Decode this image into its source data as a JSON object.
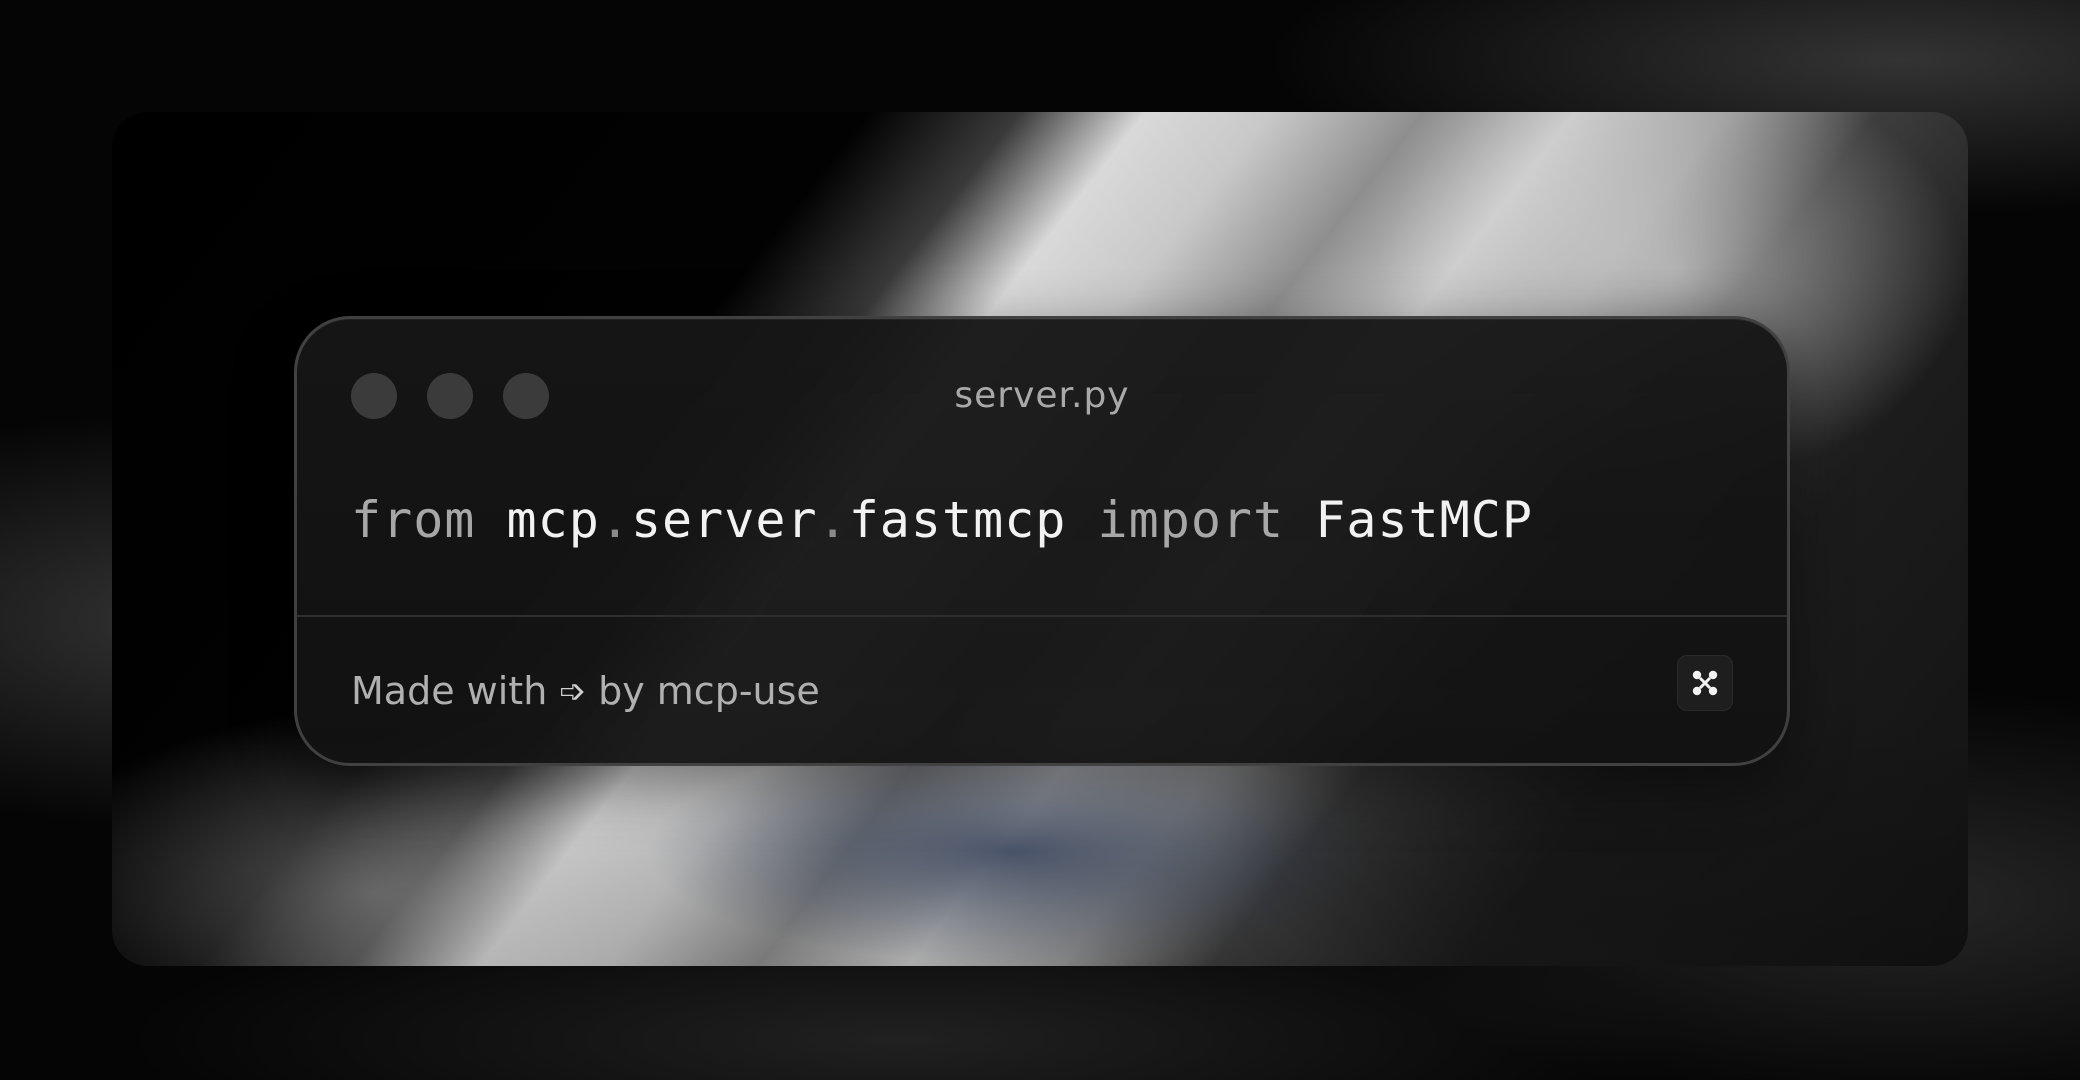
{
  "window": {
    "filename": "server.py"
  },
  "code": {
    "line": {
      "kw_from": "from",
      "mod_1": "mcp",
      "dot_1": ".",
      "mod_2": "server",
      "dot_2": ".",
      "mod_3": "fastmcp",
      "kw_import": "import",
      "name": "FastMCP"
    }
  },
  "footer": {
    "made_with": "Made with",
    "arrow_glyph": "➩",
    "by": "by mcp-use"
  },
  "icons": {
    "traffic_lights": [
      "dot-icon",
      "dot-icon",
      "dot-icon"
    ],
    "logo": "mcp-use-logo-icon"
  },
  "colors": {
    "card_bg": "#161616",
    "dot": "#3b3b3b",
    "keyword": "#a7a7a7",
    "code_text": "#f2f2f2"
  }
}
